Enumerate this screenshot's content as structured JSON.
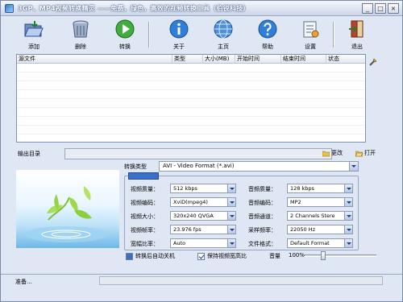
{
  "window": {
    "title": "3GP、MP4视频转换精灵 ——免费，绿色，高效的视频转换工具（伯锐科技）",
    "minimize_label": "_",
    "restore_label": "□",
    "close_label": "×"
  },
  "toolbar": {
    "add": "添加",
    "remove": "删除",
    "convert": "转换",
    "about": "关于",
    "home": "主页",
    "help": "帮助",
    "settings": "设置",
    "exit": "退出"
  },
  "filelist": {
    "columns": [
      "源文件",
      "类型",
      "大小(MB)",
      "开始时间",
      "结束时间",
      "状态"
    ]
  },
  "output": {
    "label": "输出目录",
    "value": "",
    "change": "更改",
    "open": "打开"
  },
  "conversion": {
    "type_label": "转换类型",
    "type_value": "AVI - Video Format (*.avi)"
  },
  "params": {
    "video_quality_label": "视频质量：",
    "video_quality": "512 kbps",
    "audio_quality_label": "音频质量：",
    "audio_quality": "128 kbps",
    "video_codec_label": "视频编码：",
    "video_codec": "XviD(mpeg4)",
    "audio_codec_label": "音频编码：",
    "audio_codec": "MP2",
    "video_size_label": "视频大小：",
    "video_size": "320x240 QVGA",
    "audio_channel_label": "音频通道：",
    "audio_channel": "2 Channels Stere",
    "video_fps_label": "视频帧率：",
    "video_fps": "23.976 fps",
    "sample_rate_label": "采样频率：",
    "sample_rate": "22050 Hz",
    "aspect_label": "宽幅比率：",
    "aspect": "Auto",
    "file_format_label": "文件格式：",
    "file_format": "Default Format"
  },
  "options": {
    "auto_shutdown": "转换后自动关机",
    "keep_aspect": "保持视频宽高比",
    "volume_label": "音量",
    "volume_value": "100%",
    "volume_level": 0.25
  },
  "status": {
    "text": "准备..."
  },
  "colors": {
    "window_bg": "#dfe6f4",
    "accent": "#3a6fc7"
  }
}
